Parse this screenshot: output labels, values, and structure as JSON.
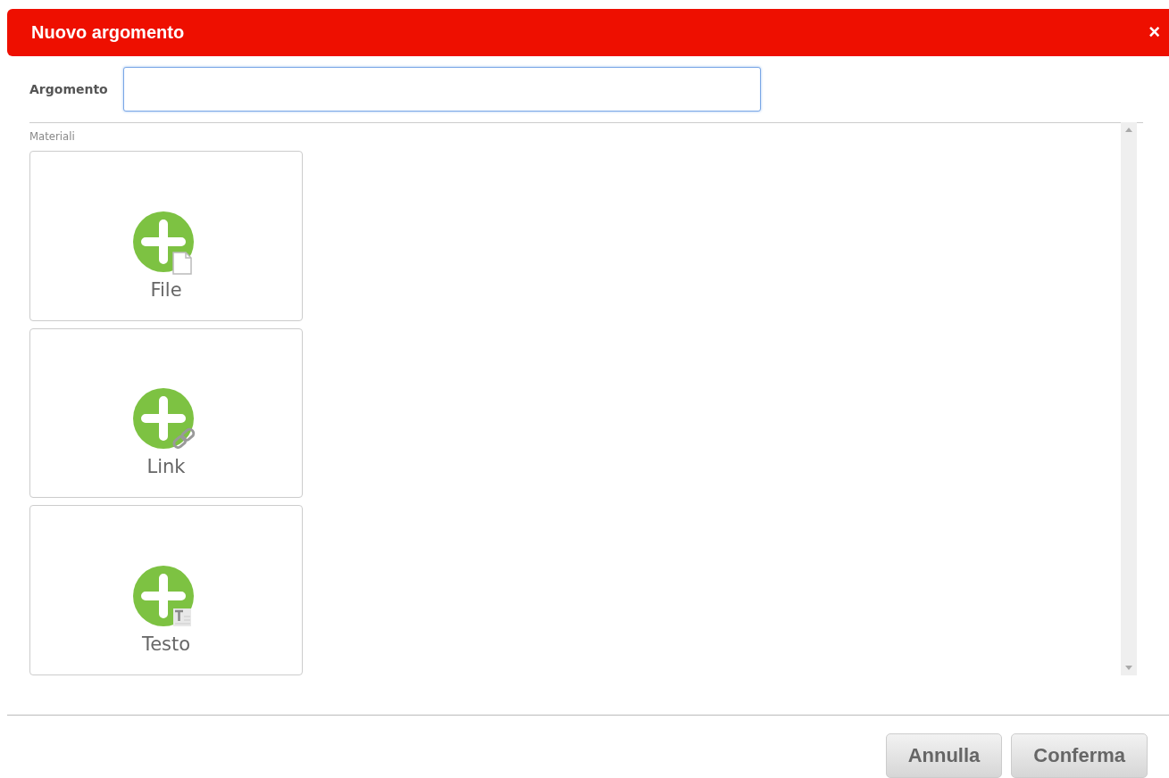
{
  "dialog": {
    "title": "Nuovo argomento",
    "close": "×"
  },
  "topic_field": {
    "label": "Argomento"
  },
  "materials": {
    "label": "Materiali",
    "items": [
      {
        "kind": "file",
        "label": "File"
      },
      {
        "kind": "link",
        "label": "Link"
      },
      {
        "kind": "text",
        "label": "Testo"
      }
    ]
  },
  "buttons": [
    "Annulla",
    "Conferma"
  ]
}
